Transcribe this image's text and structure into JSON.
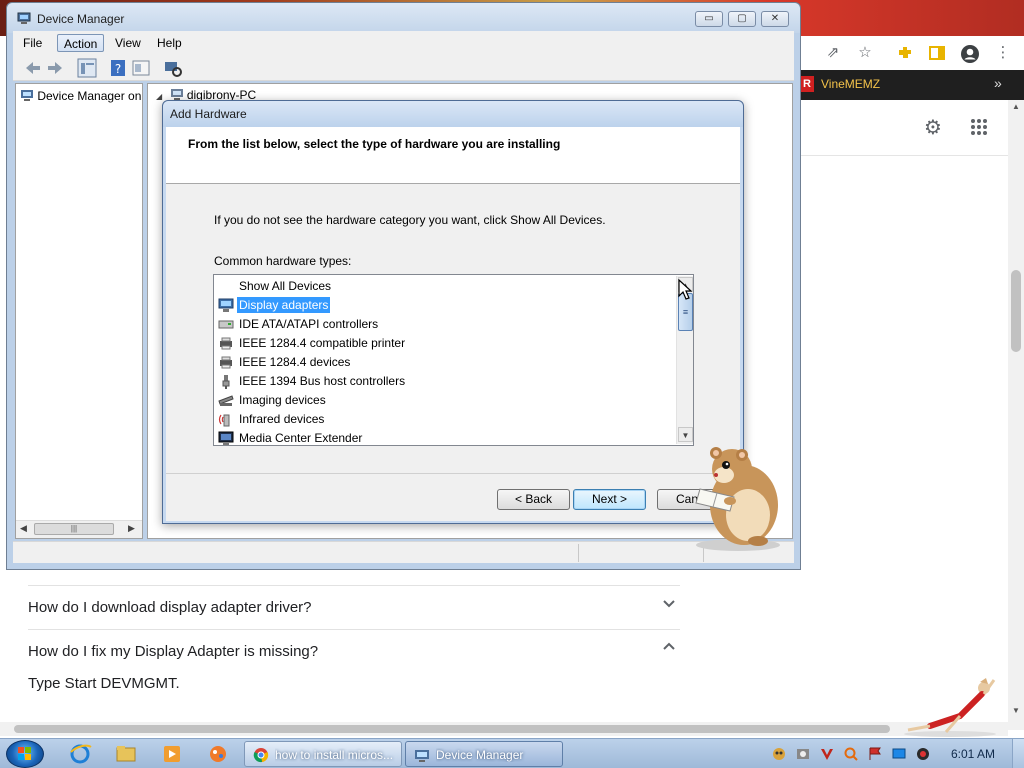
{
  "browser": {
    "bookmark_label": "VineMEMZ",
    "bookmark_logo": "R",
    "more_glyph": "»",
    "faq": [
      {
        "question": "How do I download display adapter driver?",
        "chevron": "⌄"
      },
      {
        "question": "How do I fix my Display Adapter is missing?",
        "chevron": "⌃"
      }
    ],
    "answer": "Type Start DEVMGMT."
  },
  "device_manager": {
    "title": "Device Manager",
    "menu": [
      "File",
      "Action",
      "View",
      "Help"
    ],
    "active_menu": "Action",
    "left_pane_item": "Device Manager on",
    "tree_root": "digibrony-PC",
    "caption_buttons": {
      "minimize": "▭",
      "maximize": "▢",
      "close": "✕"
    }
  },
  "add_hardware": {
    "title": "Add Hardware",
    "header": "From the list below, select the type of hardware you are installing",
    "intro": "If you do not see the hardware category you want, click Show All Devices.",
    "list_label": "Common hardware types:",
    "items": [
      {
        "label": "Show All Devices",
        "icon": "none"
      },
      {
        "label": "Display adapters",
        "icon": "monitor-icon",
        "selected": true
      },
      {
        "label": "IDE ATA/ATAPI controllers",
        "icon": "drive-icon"
      },
      {
        "label": "IEEE 1284.4 compatible printer",
        "icon": "printer-icon"
      },
      {
        "label": "IEEE 1284.4 devices",
        "icon": "printer-icon"
      },
      {
        "label": "IEEE 1394 Bus host controllers",
        "icon": "plug-icon"
      },
      {
        "label": "Imaging devices",
        "icon": "scanner-icon"
      },
      {
        "label": "Infrared devices",
        "icon": "infrared-icon"
      },
      {
        "label": "Media Center Extender",
        "icon": "monitor-icon"
      }
    ],
    "buttons": {
      "back": "< Back",
      "next": "Next >",
      "cancel": "Canc"
    }
  },
  "taskbar": {
    "tasks": [
      {
        "label": "how to install micros...",
        "icon": "chrome-icon"
      },
      {
        "label": "Device Manager",
        "icon": "device-manager-icon",
        "active": true
      }
    ],
    "clock": "6:01 AM"
  },
  "colors": {
    "selection": "#3399ff",
    "bookmark_text": "#f3c24a",
    "taskbar": "#a9c2df"
  }
}
